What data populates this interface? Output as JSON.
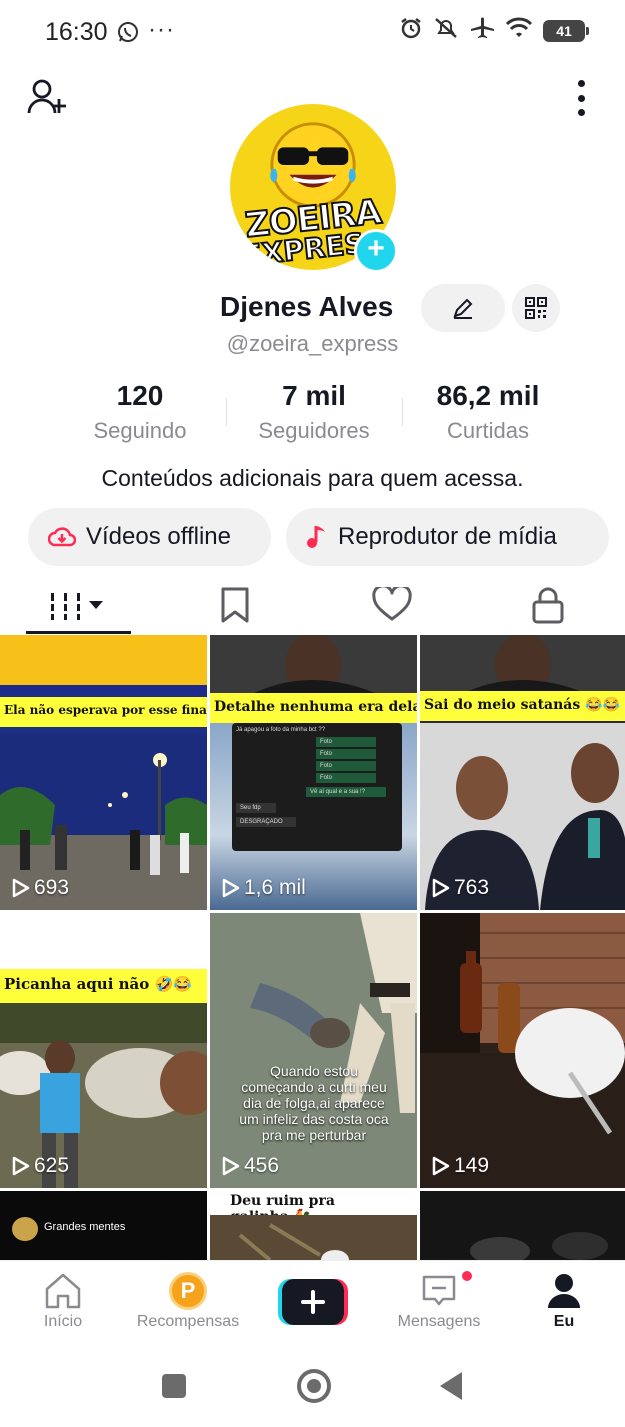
{
  "status_bar": {
    "time": "16:30",
    "more": "···",
    "battery": "41"
  },
  "profile": {
    "name": "Djenes Alves",
    "handle": "@zoeira_express",
    "avatar_logo_line1": "ZOEIRA",
    "avatar_logo_line2": "EXPRESS",
    "bio": "Conteúdos adicionais para quem acessa."
  },
  "stats": [
    {
      "value": "120",
      "label": "Seguindo"
    },
    {
      "value": "7 mil",
      "label": "Seguidores"
    },
    {
      "value": "86,2 mil",
      "label": "Curtidas"
    }
  ],
  "pills": {
    "offline": "Vídeos offline",
    "player": "Reprodutor de mídia"
  },
  "tabs": {
    "videos_icon": "grid-icon",
    "saved_icon": "bookmark-icon",
    "liked_icon": "heart-icon",
    "private_icon": "lock-icon"
  },
  "videos": [
    {
      "caption": "Ela não esperava por esse final! 😂😂",
      "views": "693"
    },
    {
      "caption": "Detalhe nenhuma era dela 😂",
      "views": "1,6 mil"
    },
    {
      "caption": "Sai do meio satanás 😂😂",
      "views": "763"
    },
    {
      "caption": "Picanha aqui não 🤣😂",
      "views": "625"
    },
    {
      "caption": "Quando estou começando a curti meu dia de folga,ai aparece um infeliz das costa oca pra me perturbar",
      "views": "456"
    },
    {
      "caption": "",
      "views": "149"
    },
    {
      "caption": "Grandes mentes",
      "views": ""
    },
    {
      "caption": "Deu ruim pra galinha 🐓",
      "views": ""
    },
    {
      "caption": "",
      "views": ""
    }
  ],
  "chat_overlay": {
    "top": "Já apagou a foto da minha bct ??",
    "items": [
      "Foto",
      "Foto",
      "Foto",
      "Foto"
    ],
    "question": "Vê aí qual e a sua !?",
    "reply": "Seu fdp",
    "end": "DESGRAÇADO"
  },
  "nav": {
    "home": "Início",
    "rewards": "Recompensas",
    "rewards_coin": "P",
    "messages": "Mensagens",
    "me": "Eu"
  },
  "colors": {
    "accent_red": "#fe2c55",
    "accent_cyan": "#20d5ec",
    "caption_yellow": "#fffe3a"
  }
}
